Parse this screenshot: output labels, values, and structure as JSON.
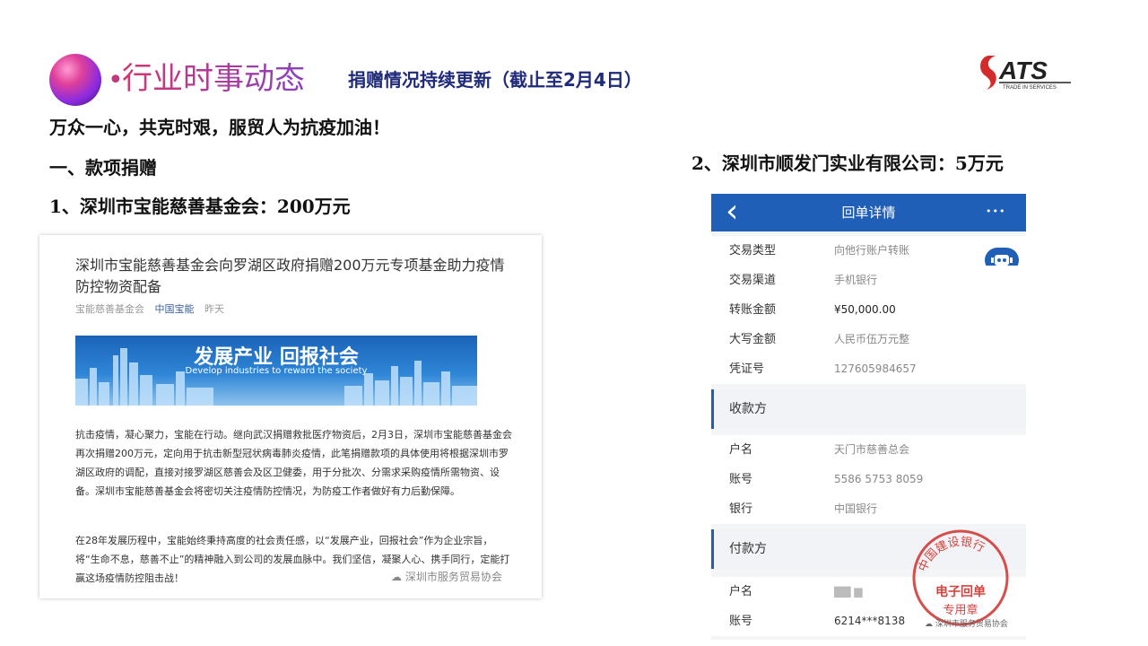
{
  "header": {
    "bullet": "•",
    "title": "行业时事动态",
    "subtitle": "捐赠情况持续更新（截止至2月4日）",
    "logo_text": "ATS",
    "logo_tagline": "TRADE IN SERVICES"
  },
  "slogan": "万众一心，共克时艰，服贸人为抗疫加油！",
  "section_heading": "一、款项捐赠",
  "item1": "1、深圳市宝能慈善基金会：200万元",
  "item2": "2、深圳市顺发门实业有限公司：5万元",
  "article": {
    "title": "深圳市宝能慈善基金会向罗湖区政府捐赠200万元专项基金助力疫情防控物资配备",
    "meta_source": "宝能慈善基金会",
    "meta_account": "中国宝能",
    "meta_time": "昨天",
    "banner_main": "发展产业  回报社会",
    "banner_sub": "Develop industries to reward the society",
    "para1": "抗击疫情，凝心聚力，宝能在行动。继向武汉捐赠救批医疗物资后，2月3日，深圳市宝能慈善基金会再次捐赠200万元，定向用于抗击新型冠状病毒肺炎疫情，此笔捐赠款项的具体使用将根据深圳市罗湖区政府的调配，直接对接罗湖区慈善会及区卫健委，用于分批次、分需求采购疫情所需物资、设备。深圳市宝能慈善基金会将密切关注疫情防控情况，为防疫工作者做好有力后勤保障。",
    "para2": "在28年发展历程中，宝能始终秉持高度的社会责任感，以“发展产业，回报社会”作为企业宗旨，将“生命不息，慈善不止”的精神融入到公司的发展血脉中。我们坚信，凝聚人心、携手同行，定能打赢这场疫情防控阻击战！",
    "watermark": "深圳市服务贸易协会"
  },
  "receipt": {
    "title": "回单详情",
    "back_icon": "‹",
    "more_icon": "•••",
    "rows_top": [
      {
        "label": "交易类型",
        "value": "向他行账户转账"
      },
      {
        "label": "交易渠道",
        "value": "手机银行"
      },
      {
        "label": "转账金额",
        "value": "¥50,000.00"
      },
      {
        "label": "大写金额",
        "value": "人民币伍万元整"
      },
      {
        "label": "凭证号",
        "value": "127605984657"
      }
    ],
    "payee_heading": "收款方",
    "payee_rows": [
      {
        "label": "户名",
        "value": "天门市慈善总会"
      },
      {
        "label": "账号",
        "value": "5586 5753 8059"
      },
      {
        "label": "银行",
        "value": "中国银行"
      }
    ],
    "payer_heading": "付款方",
    "payer_rows": [
      {
        "label": "户名",
        "value": "▇▇ ▆"
      },
      {
        "label": "账号",
        "value": "6214***8138"
      }
    ],
    "stamp_ring": "中国建设银行",
    "stamp_line1": "电子回单",
    "stamp_line2": "专用章",
    "watermark": "深圳市服务贸易协会"
  },
  "colors": {
    "title_gradient_start": "#d2386e",
    "title_gradient_end": "#8b3fc2",
    "subtitle": "#1f2a7a",
    "bank_blue": "#1f5fb8",
    "stamp_red": "#d0302a"
  }
}
